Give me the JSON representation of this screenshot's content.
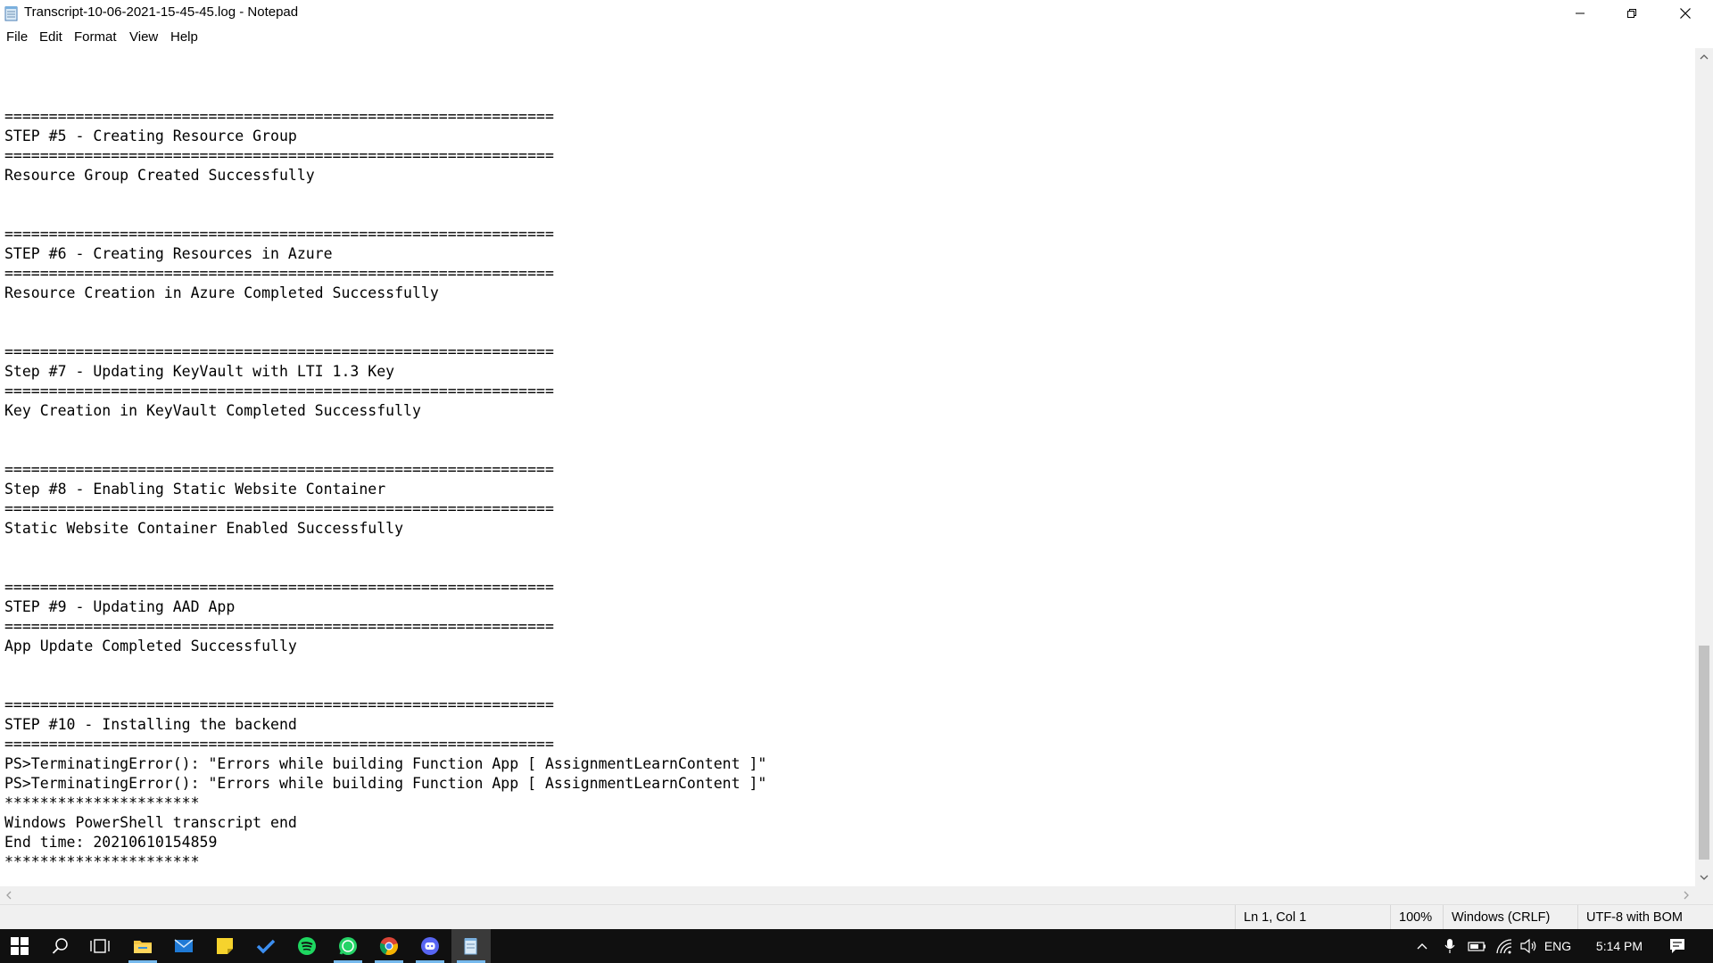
{
  "window": {
    "title": "Transcript-10-06-2021-15-45-45.log - Notepad",
    "icon": "notepad-icon"
  },
  "menu": {
    "items": [
      "File",
      "Edit",
      "Format",
      "View",
      "Help"
    ]
  },
  "editor": {
    "lines": [
      "",
      "==============================================================",
      "STEP #5 - Creating Resource Group",
      "==============================================================",
      "Resource Group Created Successfully",
      "",
      "",
      "==============================================================",
      "STEP #6 - Creating Resources in Azure",
      "==============================================================",
      "Resource Creation in Azure Completed Successfully",
      "",
      "",
      "==============================================================",
      "Step #7 - Updating KeyVault with LTI 1.3 Key",
      "==============================================================",
      "Key Creation in KeyVault Completed Successfully",
      "",
      "",
      "==============================================================",
      "Step #8 - Enabling Static Website Container",
      "==============================================================",
      "Static Website Container Enabled Successfully",
      "",
      "",
      "==============================================================",
      "STEP #9 - Updating AAD App",
      "==============================================================",
      "App Update Completed Successfully",
      "",
      "",
      "==============================================================",
      "STEP #10 - Installing the backend",
      "==============================================================",
      "PS>TerminatingError(): \"Errors while building Function App [ AssignmentLearnContent ]\"",
      "PS>TerminatingError(): \"Errors while building Function App [ AssignmentLearnContent ]\"",
      "**********************",
      "Windows PowerShell transcript end",
      "End time: 20210610154859",
      "**********************"
    ]
  },
  "statusbar": {
    "position": "Ln 1, Col 1",
    "zoom": "100%",
    "line_ending": "Windows (CRLF)",
    "encoding": "UTF-8 with BOM"
  },
  "taskbar": {
    "apps": [
      "start-icon",
      "search-icon",
      "task-view-icon",
      "file-explorer-icon",
      "mail-icon",
      "sticky-notes-icon",
      "todo-icon",
      "spotify-icon",
      "whatsapp-icon",
      "chrome-icon",
      "discord-icon",
      "notepad-icon"
    ],
    "tray": {
      "language": "ENG",
      "time": "5:14 PM"
    }
  },
  "colors": {
    "taskbar_bg": "#101010",
    "accent": "#76b9ed"
  }
}
